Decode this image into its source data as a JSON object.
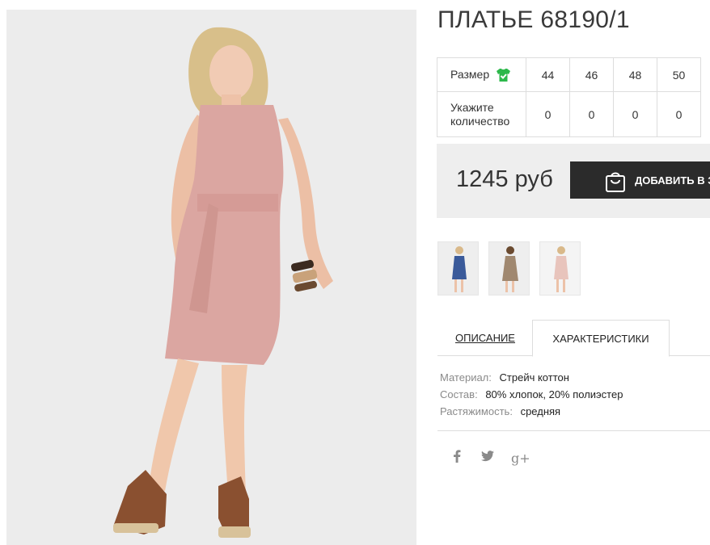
{
  "product": {
    "title": "ПЛАТЬЕ 68190/1",
    "photo_icon": "model-in-pink-dress-photo"
  },
  "sizes": {
    "size_label": "Размер",
    "size_icon": "tshirt-check-icon",
    "quantity_label": "Укажите количество",
    "options": [
      {
        "size": "44",
        "quantity": "0"
      },
      {
        "size": "46",
        "quantity": "0"
      },
      {
        "size": "48",
        "quantity": "0"
      },
      {
        "size": "50",
        "quantity": "0"
      }
    ]
  },
  "buy": {
    "price": "1245 руб",
    "add_to_cart_label": "ДОБАВИТЬ В ЗАКАЗ",
    "cart_icon": "shopping-bag-icon"
  },
  "thumbnails": [
    {
      "name": "blue-dress-thumbnail",
      "color": "#3a5a9a"
    },
    {
      "name": "beige-dress-thumbnail",
      "color": "#a08870"
    },
    {
      "name": "pink-dress-thumbnail",
      "color": "#e8c4bc"
    }
  ],
  "tabs": {
    "description": "ОПИСАНИЕ",
    "characteristics": "ХАРАКТЕРИСТИКИ",
    "active": "characteristics"
  },
  "specs": [
    {
      "key": "Материал:",
      "value": "Стрейч коттон"
    },
    {
      "key": "Состав:",
      "value": "80% хлопок, 20% полиэстер"
    },
    {
      "key": "Растяжимость:",
      "value": "средняя"
    }
  ],
  "social": {
    "facebook": "f",
    "twitter": "🐦",
    "googleplus": "g+"
  },
  "colors": {
    "accent_green": "#2db84b",
    "button_bg": "#2b2b2b",
    "buybox_bg": "#eeeeee",
    "dress_pink": "#dba6a1"
  }
}
